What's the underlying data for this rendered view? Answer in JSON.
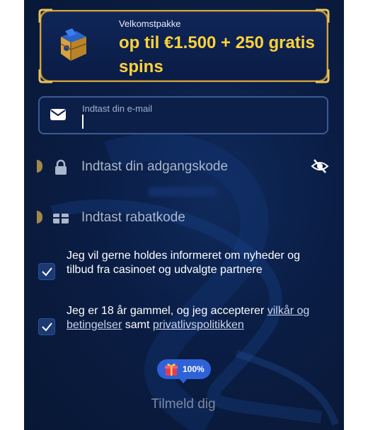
{
  "banner": {
    "kicker": "Velkomstpakke",
    "title": "op til €1.500 + 250 gratis spins",
    "icon": "treasure-chest-icon"
  },
  "email": {
    "label": "Indtast din e-mail",
    "value": "",
    "icon": "envelope-icon"
  },
  "password": {
    "placeholder": "Indtast din adgangskode",
    "icon": "lock-icon",
    "toggle_icon": "eye-slash-icon"
  },
  "promo": {
    "placeholder": "Indtast rabatkode",
    "icon": "ticket-icon"
  },
  "consents": [
    {
      "checked": true,
      "text": "Jeg vil gerne holdes informeret om nyheder og tilbud fra casinoet og udvalgte partnere"
    },
    {
      "checked": true,
      "text_before": "Jeg er 18 år gammel, og jeg accepterer",
      "link1": "vilkår og betingelser",
      "text_mid": "samt",
      "link2": "privatlivspolitikken"
    }
  ],
  "badge": {
    "icon": "gift-icon",
    "percent": "100%"
  },
  "submit_label": "Tilmeld dig",
  "colors": {
    "panel_bg": "#0a1d44",
    "gold": "#ffd23a",
    "accent_blue": "#2f62d8"
  }
}
